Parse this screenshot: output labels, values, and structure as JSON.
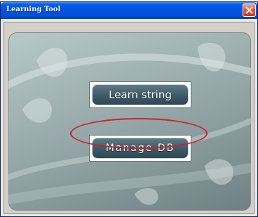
{
  "window": {
    "title": "Learning Tool"
  },
  "buttons": {
    "learn_label": "Learn string",
    "manage_label": "Manage DB"
  },
  "icons": {
    "close": "close-icon"
  },
  "colors": {
    "titlebar": "#0054e3",
    "close": "#e2573a",
    "highlight": "#d1202a"
  }
}
